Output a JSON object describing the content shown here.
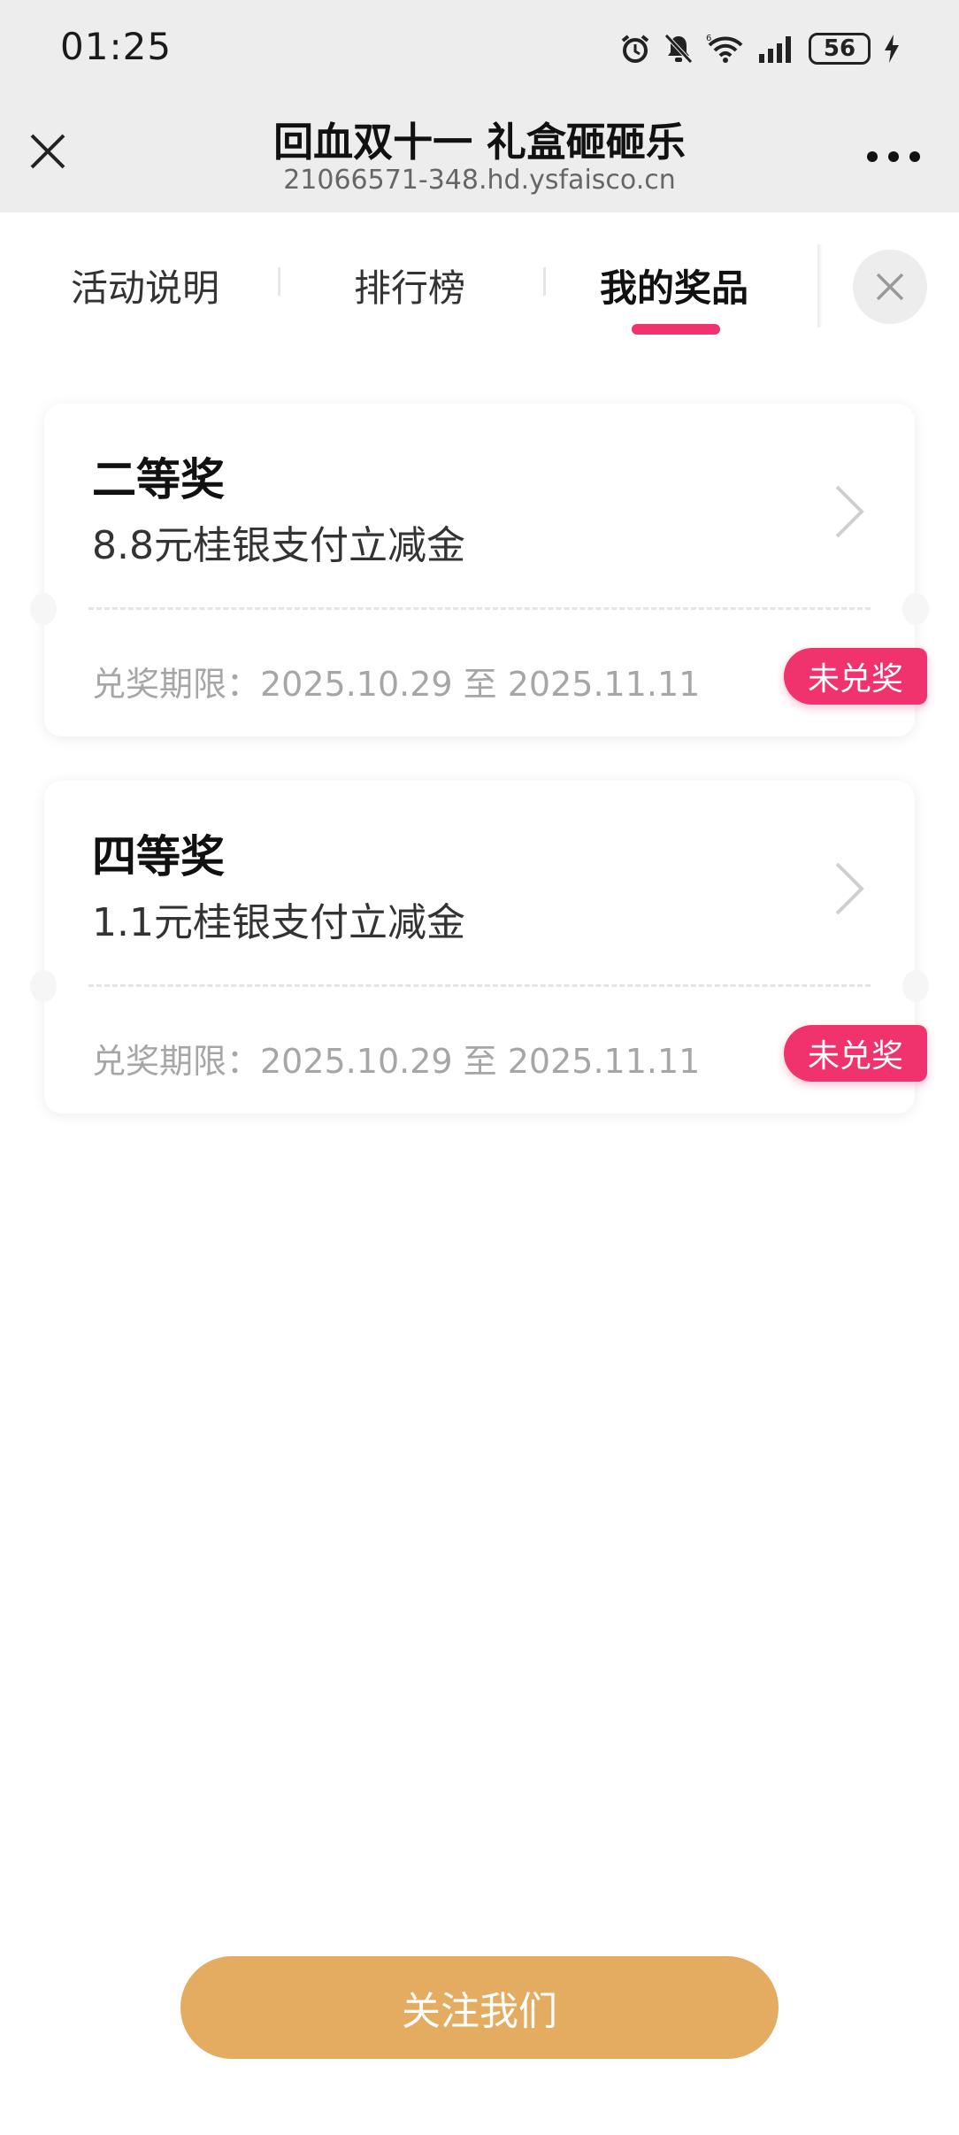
{
  "status_bar": {
    "time": "01:25",
    "battery": "56",
    "icons": [
      "alarm-icon",
      "mute-icon",
      "wifi-icon",
      "signal-icon",
      "battery-icon",
      "charging-icon"
    ]
  },
  "header": {
    "title": "回血双十一 礼盒砸砸乐",
    "subtitle": "21066571-348.hd.ysfaisco.cn"
  },
  "tabs": [
    {
      "label": "活动说明",
      "active": false
    },
    {
      "label": "排行榜",
      "active": false
    },
    {
      "label": "我的奖品",
      "active": true
    }
  ],
  "prizes": [
    {
      "level": "二等奖",
      "description": "8.8元桂银支付立减金",
      "period": "兑奖期限：2025.10.29 至 2025.11.11",
      "status": "未兑奖"
    },
    {
      "level": "四等奖",
      "description": "1.1元桂银支付立减金",
      "period": "兑奖期限：2025.10.29 至 2025.11.11",
      "status": "未兑奖"
    }
  ],
  "follow_button": "关注我们",
  "colors": {
    "accent": "#f0336d",
    "button": "#e4ac61",
    "header_bg": "#ededed"
  }
}
